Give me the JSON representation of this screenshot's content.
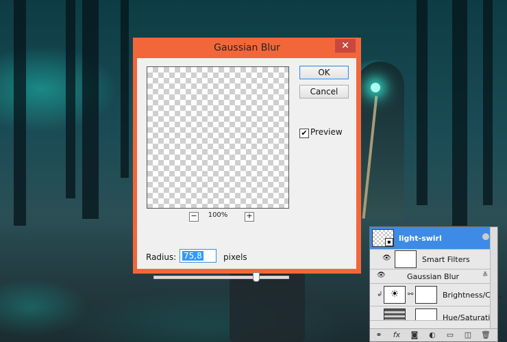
{
  "dialog": {
    "title": "Gaussian Blur",
    "close_glyph": "✕",
    "ok_label": "OK",
    "cancel_label": "Cancel",
    "preview_label": "Preview",
    "preview_checked": true,
    "zoom_out_glyph": "−",
    "zoom_in_glyph": "+",
    "zoom_level": "100%",
    "radius_label": "Radius:",
    "radius_value": "75,8",
    "radius_units": "pixels",
    "slider_fraction": 0.76
  },
  "layers_panel": {
    "rows": [
      {
        "name": "light-swirl",
        "selected": true
      },
      {
        "name": "Smart Filters"
      },
      {
        "name": "Gaussian Blur"
      },
      {
        "name": "Brightness/Co..."
      },
      {
        "name": "Hue/Saturatio..."
      }
    ],
    "footer_icons": [
      "link-icon",
      "fx-icon",
      "mask-icon",
      "adjustment-icon",
      "group-icon",
      "new-layer-icon",
      "trash-icon"
    ]
  },
  "colors": {
    "dialog_frame": "#f2673a",
    "selected_layer": "#3d8be6",
    "scene_glow": "#1ed8c8"
  }
}
